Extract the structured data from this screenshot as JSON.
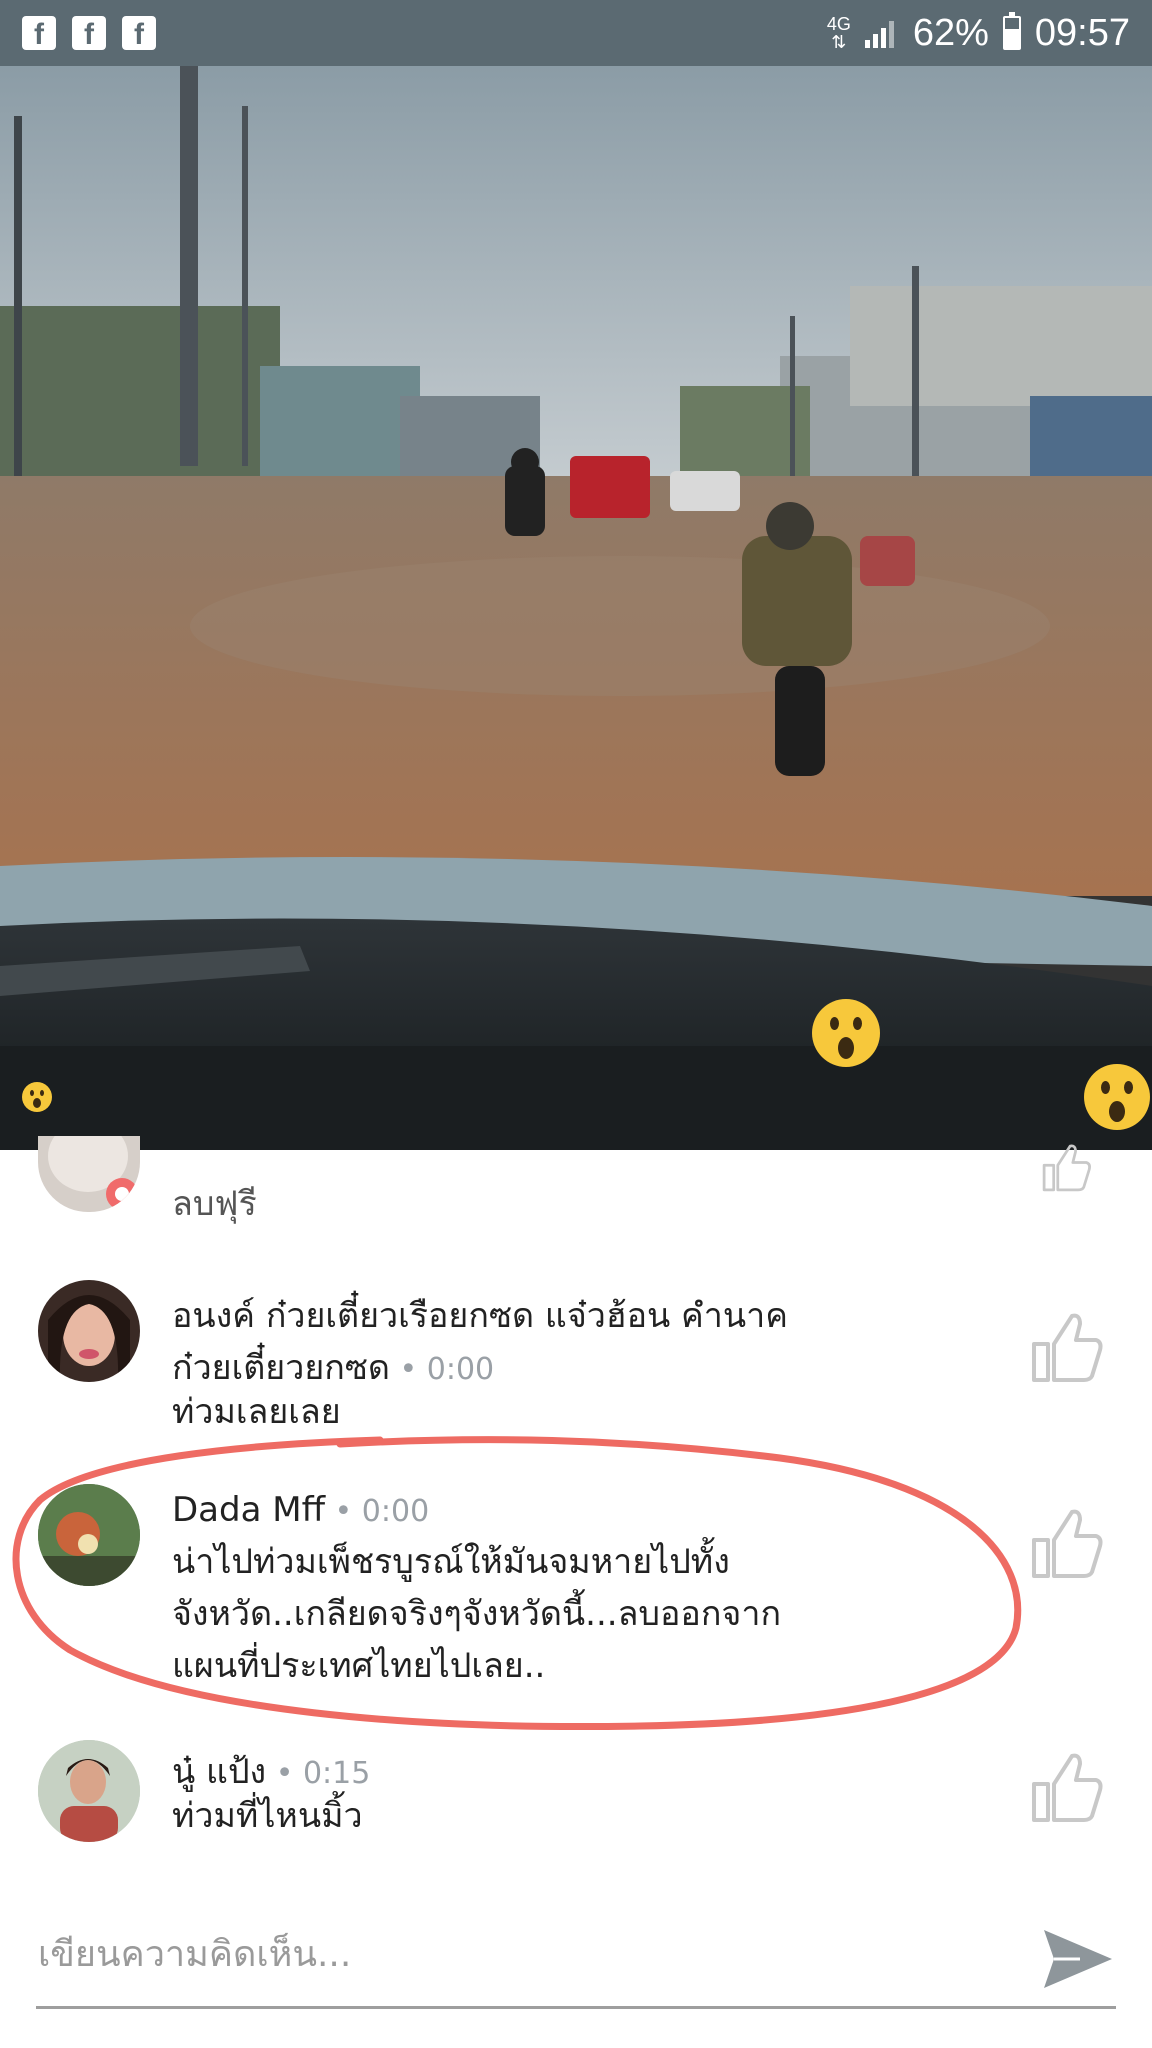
{
  "status_bar": {
    "notification_icons": [
      "f",
      "f",
      "f"
    ],
    "network": "4G",
    "battery_percent": "62%",
    "battery_level": 0.62,
    "time": "09:57"
  },
  "video": {
    "reaction_icons": [
      "wow-reaction-icon",
      "wow-reaction-icon",
      "wow-reaction-icon"
    ]
  },
  "comments": [
    {
      "author": "",
      "time": "",
      "text": "ลบฟุรี"
    },
    {
      "author": "อนงค์ ก๋วยเตี๋ยวเรือยกซด แจ๋วฮ้อน คำนาค",
      "author_line2": "ก๋วยเตี๋ยวยกซด",
      "time": "0:00",
      "text": "ท่วมเลยเลย"
    },
    {
      "author": "Dada Mff",
      "time": "0:00",
      "text_lines": [
        "น่าไปท่วมเพ็ชรบูรณ์ให้มันจมหายไปทั้ง",
        "จังหวัด..เกลียดจริงๆจังหวัดนี้...ลบออกจาก",
        "แผนที่ประเทศไทยไปเลย.."
      ]
    },
    {
      "author": "นู๋ แป้ง",
      "time": "0:15",
      "text": "ท่วมที่ไหนมิ้ว"
    }
  ],
  "composer": {
    "placeholder": "เขียนความคิดเห็น..."
  },
  "colors": {
    "status_bar": "#5b6a72",
    "highlight_circle": "#ee6b63",
    "like_icon": "#c8c8c8"
  }
}
